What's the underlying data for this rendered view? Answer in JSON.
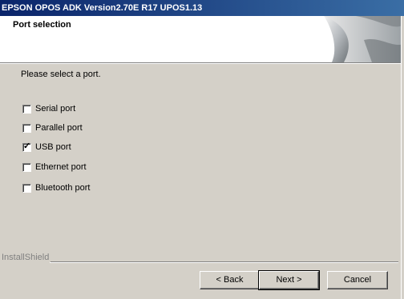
{
  "window": {
    "title": "EPSON OPOS ADK Version2.70E R17 UPOS1.13"
  },
  "header": {
    "title": "Port selection"
  },
  "prompt": "Please select a port.",
  "options": [
    {
      "label": "Serial port",
      "checked": false
    },
    {
      "label": "Parallel port",
      "checked": false
    },
    {
      "label": "USB port",
      "checked": true
    },
    {
      "label": "Ethernet port",
      "checked": false
    },
    {
      "label": "Bluetooth port",
      "checked": false
    }
  ],
  "check_glyph": "✓",
  "footer": {
    "brand": "InstallShield"
  },
  "buttons": {
    "back": "< Back",
    "next": "Next >",
    "cancel": "Cancel"
  }
}
